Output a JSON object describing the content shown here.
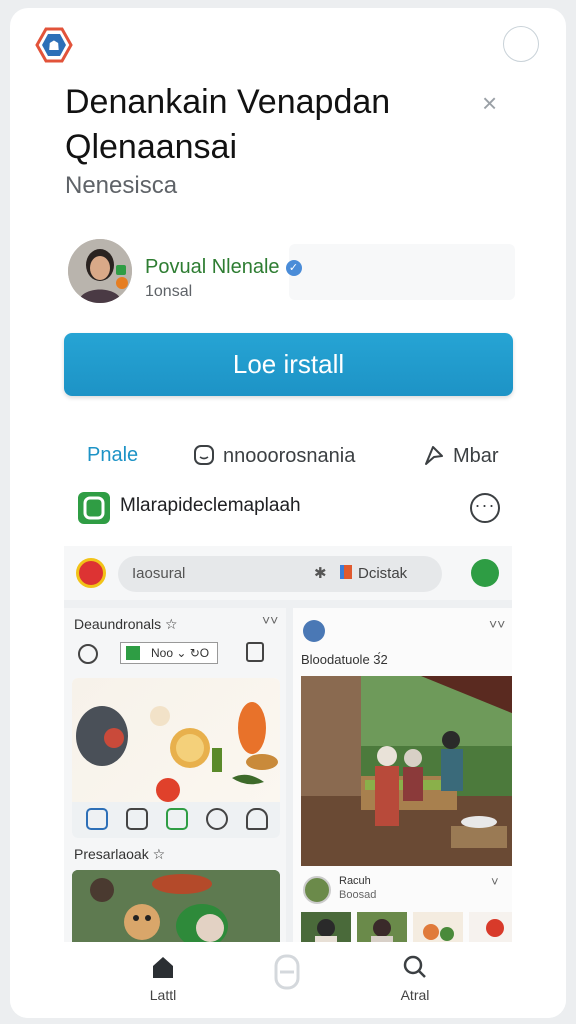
{
  "header": {
    "title_line1": "Denankain Venapdan",
    "title_line2": "Qlenaansai",
    "close_glyph": "×",
    "subtitle": "Nenesisca"
  },
  "author": {
    "name": "Povual Nlenale",
    "verified_glyph": "✓",
    "meta": "1onsal"
  },
  "install_label": "Loe irstall",
  "actions": [
    {
      "label": "Pnale",
      "icon": "none"
    },
    {
      "label": "nnooorosnania",
      "icon": "message-icon"
    },
    {
      "label": "Mbar",
      "icon": "share-icon"
    }
  ],
  "app": {
    "name": "Mlarapideclemaplaah",
    "more_glyph": "···"
  },
  "preview": {
    "search_placeholder": "Iaosural",
    "star_glyph": "✱",
    "doc_label": "Dcistak",
    "left": {
      "heading1": "Deaundronals ☆",
      "close1": "˅˅",
      "chip_label": "Noo ⌄ ↻O",
      "heading2": "Presarlaoak ☆"
    },
    "right": {
      "close1": "˅˅",
      "heading": "Bloodatuole  3́2",
      "post_name": "Racuh",
      "post_sub": "Boosad",
      "close2": "˅"
    }
  },
  "bottom_nav": {
    "home_label": "Lattl",
    "search_label": "Atral"
  },
  "colors": {
    "accent": "#1d93c6",
    "verified": "#4a8cd8",
    "author_green": "#2e7d32",
    "app_green": "#2f9d44"
  }
}
